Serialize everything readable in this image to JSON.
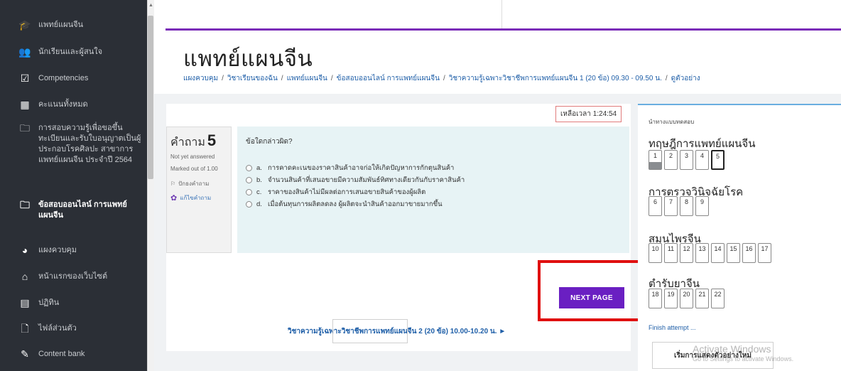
{
  "sidebar": {
    "items": [
      {
        "icon": "graduation-cap-icon",
        "glyph": "🎓",
        "label": "แพทย์แผนจีน"
      },
      {
        "icon": "users-icon",
        "glyph": "👥",
        "label": "นักเรียนและผู้สนใจ"
      },
      {
        "icon": "checkbox-icon",
        "glyph": "☑",
        "label": "Competencies"
      },
      {
        "icon": "table-icon",
        "glyph": "▦",
        "label": "คะแนนทั้งหมด"
      },
      {
        "icon": "folder-icon",
        "glyph": "🗀",
        "label": "การสอบความรู้เพื่อขอขึ้นทะเบียนและรับใบอนุญาตเป็นผู้ประกอบโรคศิลปะ สาขาการแพทย์แผนจีน ประจำปี 2564"
      },
      {
        "icon": "folder-icon",
        "glyph": "🗀",
        "label": "ข้อสอบออนไลน์ การแพทย์แผนจีน"
      },
      {
        "icon": "dashboard-icon",
        "glyph": "◕",
        "label": "แผงควบคุม"
      },
      {
        "icon": "home-icon",
        "glyph": "⌂",
        "label": "หน้าแรกของเว็บไซต์"
      },
      {
        "icon": "calendar-icon",
        "glyph": "▤",
        "label": "ปฏิทิน"
      },
      {
        "icon": "file-icon",
        "glyph": "🗋",
        "label": "ไฟล์ส่วนตัว"
      },
      {
        "icon": "paintbrush-icon",
        "glyph": "✎",
        "label": "Content bank"
      }
    ]
  },
  "page": {
    "title": "แพทย์แผนจีน",
    "breadcrumb": [
      "แผงควบคุม",
      "วิชาเรียนของฉัน",
      "แพทย์แผนจีน",
      "ข้อสอบออนไลน์ การแพทย์แผนจีน",
      "วิชาความรู้เฉพาะวิชาชีพการแพทย์แผนจีน 1 (20 ข้อ) 09.30 - 09.50 น.",
      "ดูตัวอย่าง"
    ]
  },
  "timer": "เหลือเวลา 1:24:54",
  "question": {
    "word": "คำถาม",
    "number": "5",
    "status": "Not yet answered",
    "marked": "Marked out of 1.00",
    "flag_label": "ปักธงคำถาม",
    "edit_label": "แก้ไขคำถาม",
    "text": "ข้อใดกล่าวผิด?",
    "answers": [
      {
        "letter": "a.",
        "text": "การคาดคะเนของราคาสินค้าอาจก่อให้เกิดปัญหาการกักตุนสินค้า"
      },
      {
        "letter": "b.",
        "text": "จำนวนสินค้าที่เสนอขายมีความสัมพันธ์ทิศทางเดียวกันกับราคาสินค้า"
      },
      {
        "letter": "c.",
        "text": "ราคาของสินค้าไม่มีผลต่อการเสนอขายสินค้าของผู้ผลิต"
      },
      {
        "letter": "d.",
        "text": "เมื่อต้นทุนการผลิตลดลง ผู้ผลิตจะนำสินค้าออกมาขายมากขึ้น"
      }
    ]
  },
  "next_button": "NEXT PAGE",
  "next_link": "วิชาความรู้เฉพาะวิชาชีพการแพทย์แผนจีน 2 (20 ข้อ) 10.00-10.20 น. ►",
  "nav": {
    "title": "นำทางแบบทดสอบ",
    "sections": [
      {
        "name": "ทฤษฎีการแพทย์แผนจีน",
        "buttons": [
          "1",
          "2",
          "3",
          "4",
          "5"
        ]
      },
      {
        "name": "การตรวจวินิจฉัยโรค",
        "buttons": [
          "6",
          "7",
          "8",
          "9"
        ]
      },
      {
        "name": "สมุนไพรจีน",
        "buttons": [
          "10",
          "11",
          "12",
          "13",
          "14",
          "15",
          "16",
          "17"
        ]
      },
      {
        "name": "ตำรับยาจีน",
        "buttons": [
          "18",
          "19",
          "20",
          "21",
          "22"
        ]
      }
    ],
    "answered": [
      "1"
    ],
    "current": "5",
    "finish_label": "Finish attempt ...",
    "restart_label": "เริ่มการแสดงตัวอย่างใหม่"
  },
  "watermark": {
    "line1": "Activate Windows",
    "line2": "Go to Settings to activate Windows."
  }
}
